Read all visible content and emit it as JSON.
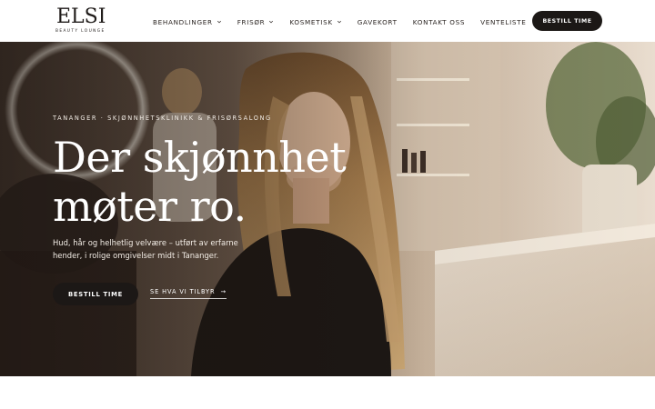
{
  "brand": {
    "logo_text": "ELSI",
    "logo_subtitle": "BEAUTY LOUNGE"
  },
  "nav": {
    "items": [
      {
        "label": "BEHANDLINGER",
        "has_dropdown": true
      },
      {
        "label": "FRISØR",
        "has_dropdown": true
      },
      {
        "label": "KOSMETISK",
        "has_dropdown": true
      },
      {
        "label": "GAVEKORT",
        "has_dropdown": false
      },
      {
        "label": "KONTAKT OSS",
        "has_dropdown": false
      },
      {
        "label": "VENTELISTE",
        "has_dropdown": false
      }
    ],
    "cta_label": "BESTILL TIME"
  },
  "hero": {
    "eyebrow": "TANANGER · SKJØNNHETSKLINIKK & FRISØRSALONG",
    "headline_line1": "Der skjønnhet",
    "headline_line2": "møter ro.",
    "subtext": "Hud, hår og helhetlig velvære – utført av erfarne hender, i rolige omgivelser midt i Tananger.",
    "primary_cta": "BESTILL TIME",
    "secondary_cta": "SE HVA VI TILBYR",
    "secondary_cta_arrow": "→"
  },
  "colors": {
    "cta_background": "#1c1816",
    "header_background": "#ffffff",
    "text_dark": "#2b2522",
    "hero_text": "#ffffff"
  },
  "icons": {
    "dropdown": "chevron-down-icon",
    "link_arrow": "arrow-right-icon"
  }
}
